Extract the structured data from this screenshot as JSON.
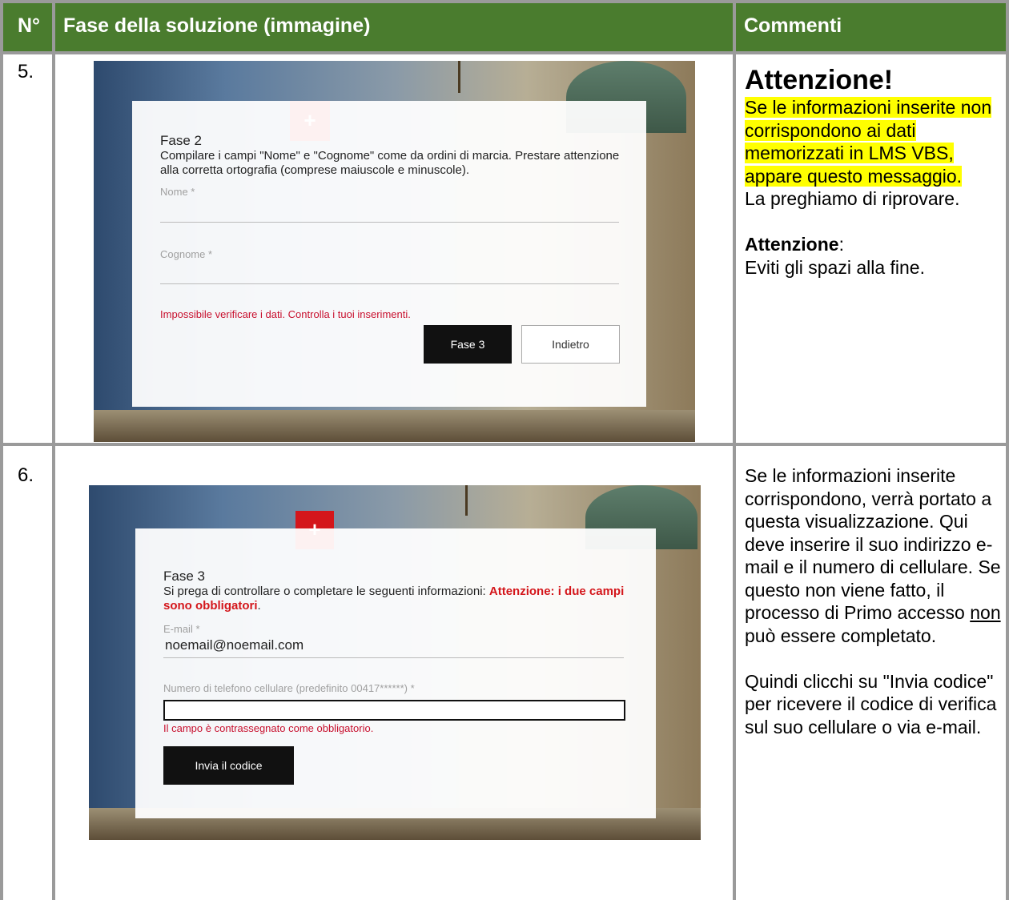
{
  "header": {
    "col_num": "N°",
    "col_phase": "Fase della soluzione (immagine)",
    "col_comments": "Commenti"
  },
  "rows": [
    {
      "number": "5.",
      "screenshot": {
        "step_title": "Fase 2",
        "instructions": "Compilare i campi \"Nome\" e \"Cognome\" come da ordini di marcia. Prestare attenzione alla corretta ortografia (comprese maiuscole e minuscole).",
        "first_name_label": "Nome *",
        "last_name_label": "Cognome *",
        "error": "Impossibile verificare i dati. Controlla i tuoi inserimenti.",
        "next_button": "Fase 3",
        "back_button": "Indietro"
      },
      "comment": {
        "heading": "Attenzione!",
        "highlighted": "Se le informazioni inserite non corrispondono ai dati memorizzati in LMS VBS, appare questo messaggio.",
        "retry": "La preghiamo di riprovare.",
        "warning_label": "Attenzione",
        "warning_colon": ":",
        "warning_text": "Eviti gli spazi alla fine."
      }
    },
    {
      "number": "6.",
      "screenshot": {
        "step_title": "Fase 3",
        "instructions": "Si prega di controllare o completare le seguenti informazioni: ",
        "instructions_red": "Attenzione: i due campi sono obbligatori",
        "instructions_end": ".",
        "email_label": "E-mail *",
        "email_value": "noemail@noemail.com",
        "phone_label": "Numero di telefono cellulare (predefinito 00417******) *",
        "phone_error": "Il campo è contrassegnato come obbligatorio.",
        "send_button": "Invia il codice"
      },
      "comment": {
        "p1_a": "Se le informazioni inserite corrispondono, verrà portato a questa visualizzazione. Qui deve inserire il suo indirizzo e-mail e il numero di cellulare. Se questo non viene fatto, il processo di Primo accesso ",
        "p1_u": "non",
        "p1_b": " può essere completato.",
        "p2": "Quindi clicchi su \"Invia codice\" per ricevere il codice di verifica sul suo cellulare o via e-mail."
      }
    }
  ],
  "colors": {
    "header_bg": "#4a7c2e",
    "highlight": "#ffff00",
    "error_red": "#c8102e"
  }
}
